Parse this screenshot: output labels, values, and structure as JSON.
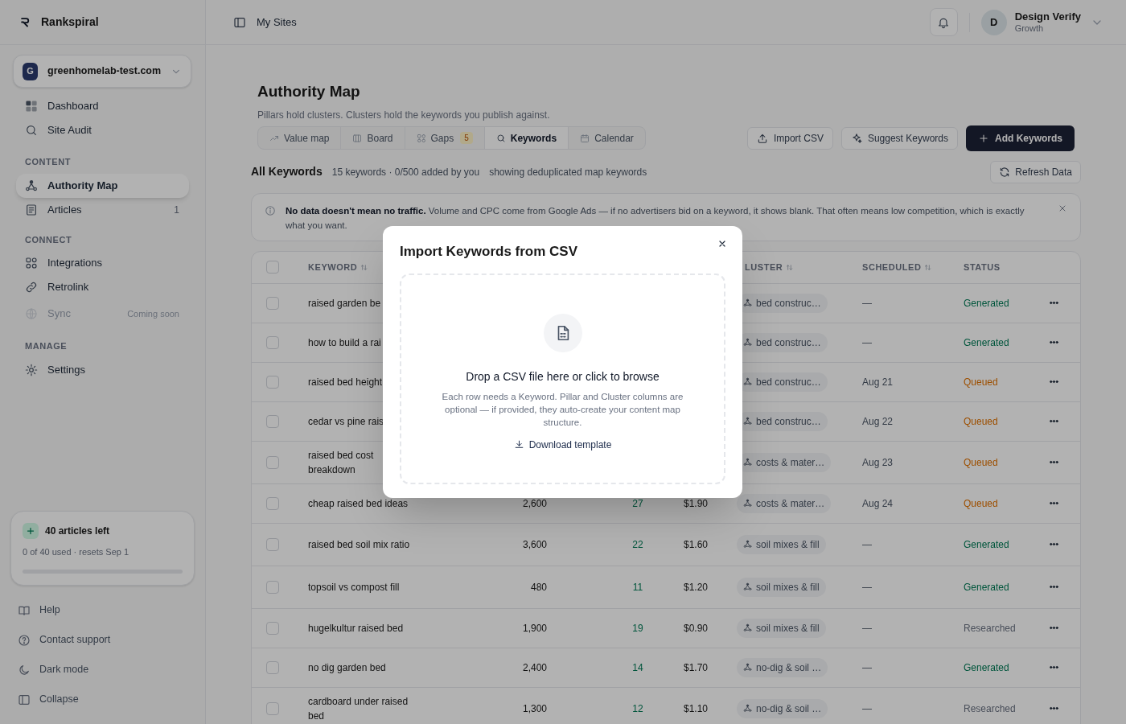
{
  "brand": {
    "name": "Rankspiral"
  },
  "site": {
    "initial": "G",
    "domain": "greenhomelab-test.com"
  },
  "sidebar": {
    "sections": [
      {
        "items": [
          {
            "label": "Dashboard",
            "selected": false
          },
          {
            "label": "Site Audit",
            "selected": false
          }
        ]
      },
      {
        "heading": "CONTENT",
        "items": [
          {
            "label": "Authority Map",
            "selected": true
          },
          {
            "label": "Articles",
            "selected": false,
            "count": "1"
          }
        ]
      },
      {
        "heading": "CONNECT",
        "items": [
          {
            "label": "Integrations",
            "selected": false
          },
          {
            "label": "Retrolink",
            "selected": false
          },
          {
            "label": "Sync",
            "selected": false,
            "disabled": true,
            "note": "Coming soon"
          }
        ]
      },
      {
        "heading": "MANAGE",
        "items": [
          {
            "label": "Settings",
            "selected": false
          }
        ]
      }
    ],
    "usage": {
      "title": "40 articles left",
      "detail": "0 of 40 used · resets Sep 1",
      "level": 0
    },
    "footer": [
      {
        "label": "Help"
      },
      {
        "label": "Contact support"
      },
      {
        "label": "Dark mode"
      },
      {
        "label": "Collapse"
      }
    ]
  },
  "header": {
    "breadcrumb": "My Sites",
    "user": {
      "initial": "D",
      "name": "Design Verify",
      "plan": "Growth"
    }
  },
  "page": {
    "title": "Authority Map",
    "subtitle": "Pillars hold clusters. Clusters hold the keywords you publish against.",
    "tabs": [
      {
        "label": "Value map",
        "selected": false
      },
      {
        "label": "Board",
        "selected": false
      },
      {
        "label": "Gaps",
        "selected": false,
        "badge": "5"
      },
      {
        "label": "Keywords",
        "selected": true
      },
      {
        "label": "Calendar",
        "selected": false
      }
    ],
    "actions": [
      {
        "label": "Import CSV",
        "kind": "outline"
      },
      {
        "label": "Suggest Keywords",
        "kind": "outline"
      },
      {
        "label": "Add Keywords",
        "kind": "primary"
      }
    ],
    "section": {
      "title": "All Keywords",
      "meta": "15 keywords · 0/500 added by you",
      "note": "showing deduplicated map keywords",
      "refresh": "Refresh Data"
    },
    "banner": {
      "text": "**No data doesn't mean no traffic.** Volume and CPC come from Google Ads — if no advertisers bid on a keyword, it shows blank. That often means low competition, which is exactly what you want."
    }
  },
  "table": {
    "all_checked": false,
    "columns": {
      "keyword": "KEYWORD",
      "cluster": "LUSTER",
      "scheduled": "SCHEDULED",
      "status": "STATUS"
    },
    "rows": [
      {
        "checked": false,
        "keyword": "raised garden be",
        "cluster": "bed construc…",
        "scheduled": "—",
        "status": "Generated",
        "kind": "generated"
      },
      {
        "checked": false,
        "keyword": "how to build a rai",
        "cluster": "bed construc…",
        "scheduled": "—",
        "status": "Generated",
        "kind": "generated"
      },
      {
        "checked": false,
        "keyword": "raised bed height",
        "cluster": "bed construc…",
        "scheduled": "Aug 21",
        "status": "Queued",
        "kind": "queued"
      },
      {
        "checked": false,
        "keyword": "cedar vs pine rais",
        "cluster": "bed construc…",
        "scheduled": "Aug 22",
        "status": "Queued",
        "kind": "queued"
      },
      {
        "checked": false,
        "keyword": "raised bed cost breakdown",
        "cluster": "costs & mater…",
        "scheduled": "Aug 23",
        "status": "Queued",
        "kind": "queued"
      },
      {
        "checked": false,
        "keyword": "cheap raised bed ideas",
        "volume": "2,600",
        "kd": "27",
        "cpc": "$1.90",
        "cluster": "costs & mater…",
        "scheduled": "Aug 24",
        "status": "Queued",
        "kind": "queued"
      },
      {
        "checked": false,
        "keyword": "raised bed soil mix ratio",
        "volume": "3,600",
        "kd": "22",
        "cpc": "$1.60",
        "cluster": "soil mixes & fill",
        "scheduled": "—",
        "status": "Generated",
        "kind": "generated"
      },
      {
        "checked": false,
        "keyword": "topsoil vs compost fill",
        "volume": "480",
        "kd": "11",
        "cpc": "$1.20",
        "cluster": "soil mixes & fill",
        "scheduled": "—",
        "status": "Generated",
        "kind": "generated"
      },
      {
        "checked": false,
        "keyword": "hugelkultur raised bed",
        "volume": "1,900",
        "kd": "19",
        "cpc": "$0.90",
        "cluster": "soil mixes & fill",
        "scheduled": "—",
        "status": "Researched",
        "kind": "researched"
      },
      {
        "checked": false,
        "keyword": "no dig garden bed",
        "volume": "2,400",
        "kd": "14",
        "cpc": "$1.70",
        "cluster": "no-dig & soil …",
        "scheduled": "—",
        "status": "Generated",
        "kind": "generated"
      },
      {
        "checked": false,
        "keyword": "cardboard under raised bed",
        "volume": "1,300",
        "kd": "12",
        "cpc": "$1.10",
        "cluster": "no-dig & soil …",
        "scheduled": "—",
        "status": "Researched",
        "kind": "researched"
      }
    ]
  },
  "modal": {
    "title": "Import Keywords from CSV",
    "drop_title": "Drop a CSV file here or click to browse",
    "drop_text": "Each row needs a Keyword. Pillar and Cluster columns are optional — if provided, they auto-create your content map structure.",
    "template_link": "Download template"
  }
}
